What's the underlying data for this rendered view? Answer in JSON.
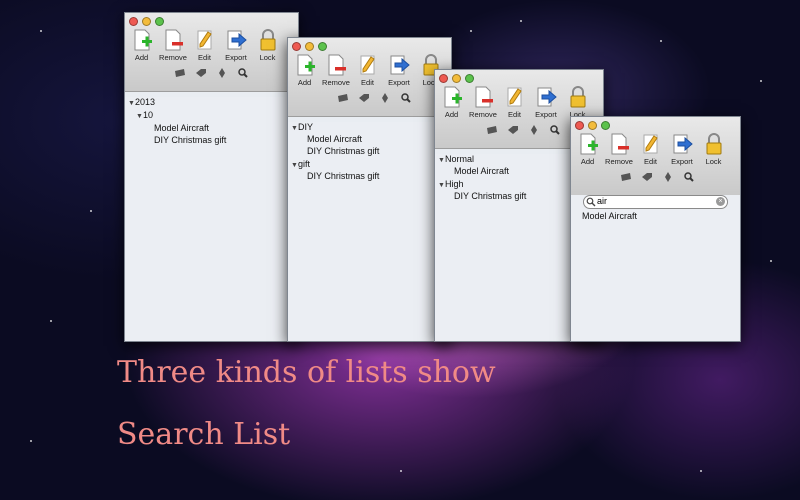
{
  "background": {
    "accent": "#b04cc0"
  },
  "toolbar": {
    "add": "Add",
    "remove": "Remove",
    "edit": "Edit",
    "export": "Export",
    "lock": "Lock"
  },
  "windows": {
    "date": {
      "rows": [
        "2013",
        "10",
        "Model Aircraft",
        "DIY Christmas gift"
      ]
    },
    "category": {
      "rows": [
        "DIY",
        "Model Aircraft",
        "DIY Christmas gift",
        "gift",
        "DIY Christmas gift"
      ]
    },
    "priority": {
      "rows": [
        "Normal",
        "Model Aircraft",
        "High",
        "DIY Christmas gift"
      ]
    },
    "search": {
      "query": "air",
      "results": [
        "Model Aircraft"
      ]
    }
  },
  "captions": {
    "line1": "Three kinds of lists show",
    "line2": "Search List"
  },
  "colors": {
    "caption": "#f08a86"
  }
}
